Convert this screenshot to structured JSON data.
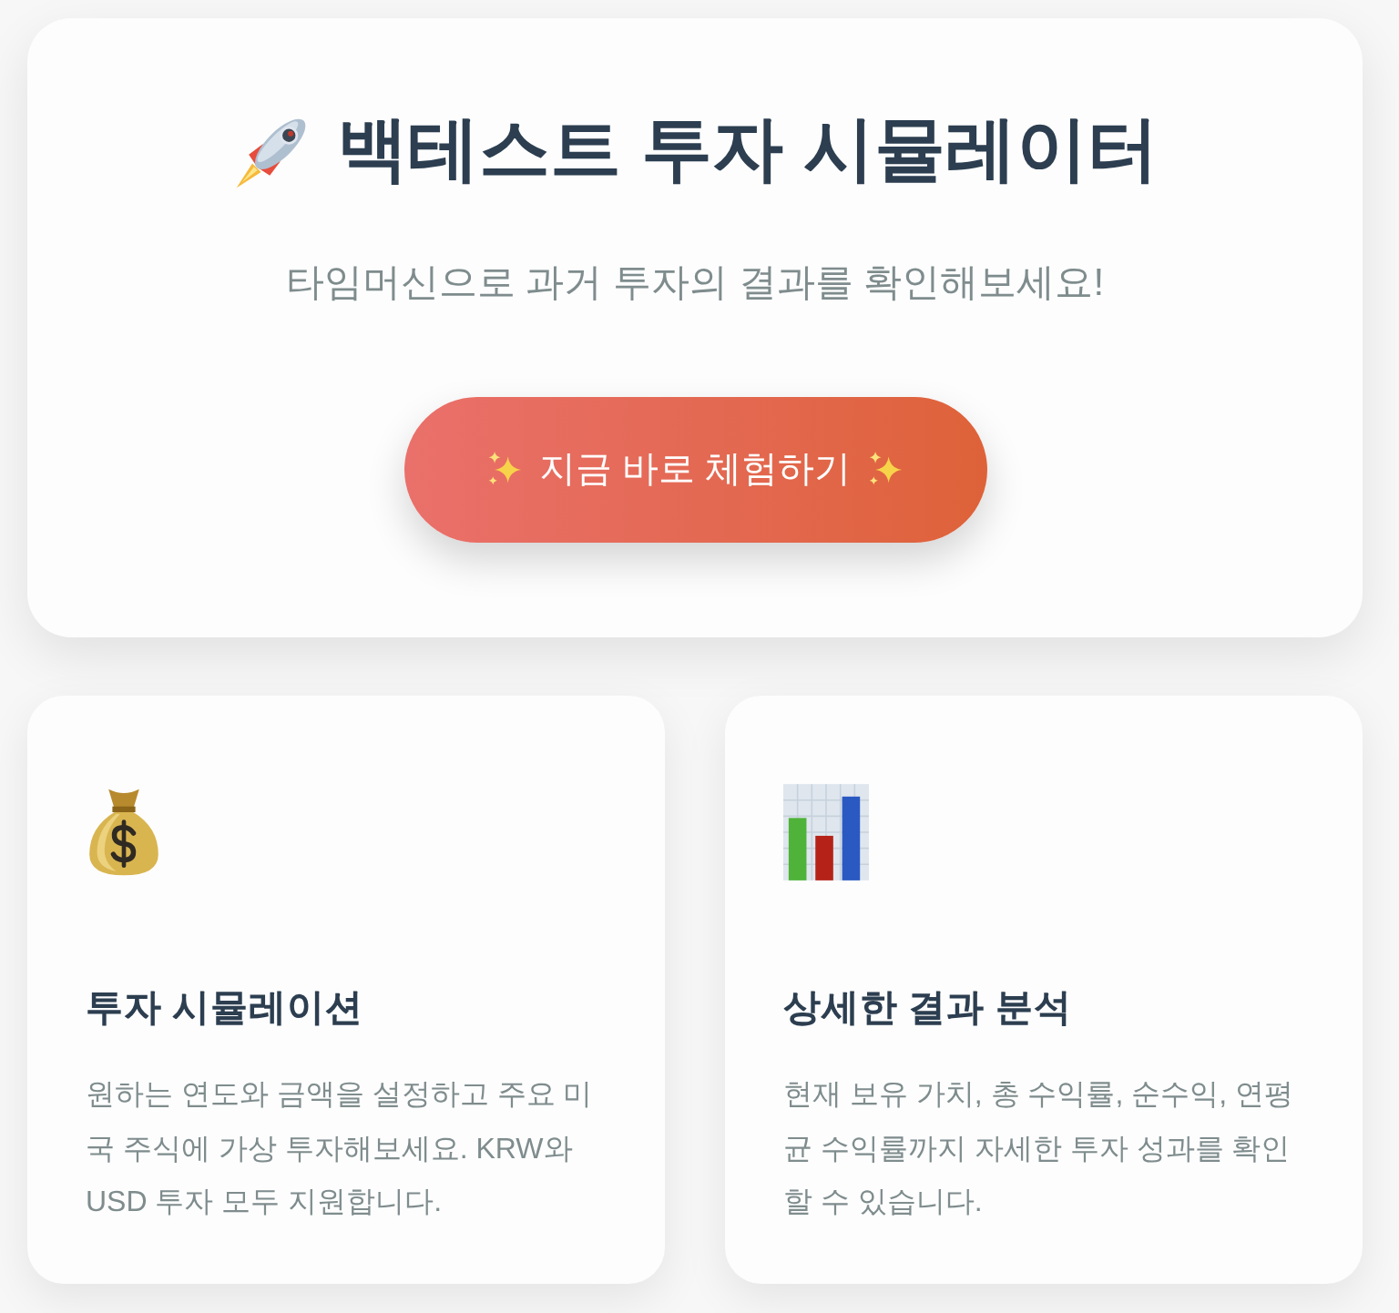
{
  "hero": {
    "title": "백테스트 투자 시뮬레이터",
    "subtitle": "타임머신으로 과거 투자의 결과를 확인해보세요!",
    "cta": {
      "label": "지금 바로 체험하기"
    }
  },
  "features": [
    {
      "kind": "money",
      "title": "투자 시뮬레이션",
      "description": "원하는 연도와 금액을 설정하고 주요 미국 주식에 가상 투자해보세요. KRW와 USD 투자 모두 지원합니다."
    },
    {
      "kind": "chart",
      "title": "상세한 결과 분석",
      "description": "현재 보유 가치, 총 수익률, 순수익, 연평균 수익률까지 자세한 투자 성과를 확인할 수 있습니다."
    }
  ]
}
